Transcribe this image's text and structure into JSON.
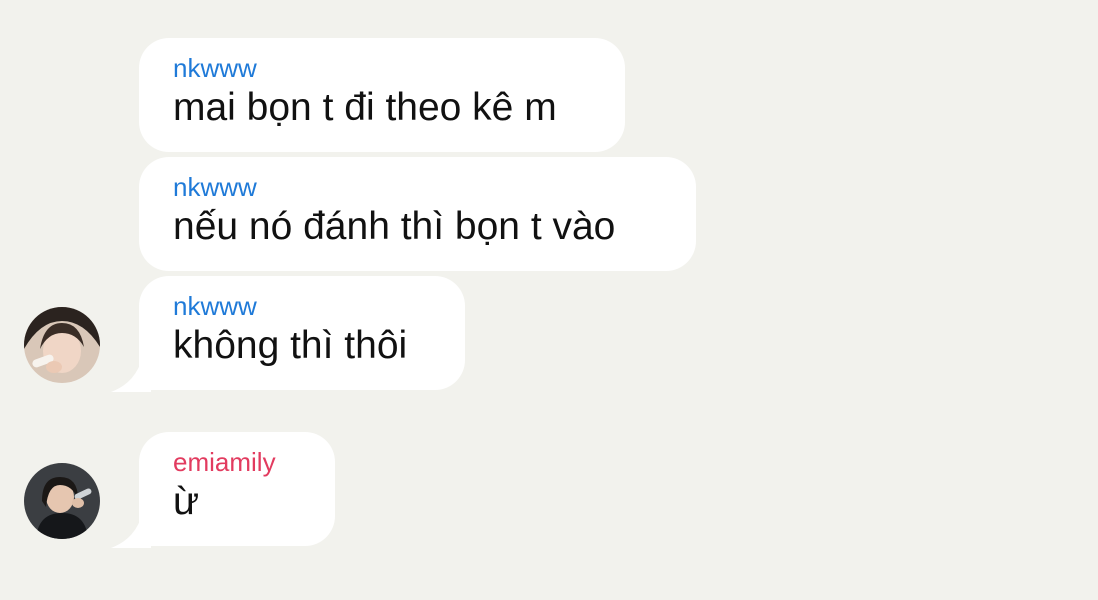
{
  "messages": [
    {
      "sender": "nkwww",
      "text": "mai bọn t đi theo kê m"
    },
    {
      "sender": "nkwww",
      "text": "nếu nó đánh thì bọn t vào"
    },
    {
      "sender": "nkwww",
      "text": "không thì thôi"
    },
    {
      "sender": "emiamily",
      "text": "ừ"
    }
  ],
  "colors": {
    "background": "#f2f2ed",
    "bubble": "#ffffff",
    "sender_nkwww": "#1f7ad8",
    "sender_emiamily": "#e23b5f",
    "message_text": "#111111"
  }
}
